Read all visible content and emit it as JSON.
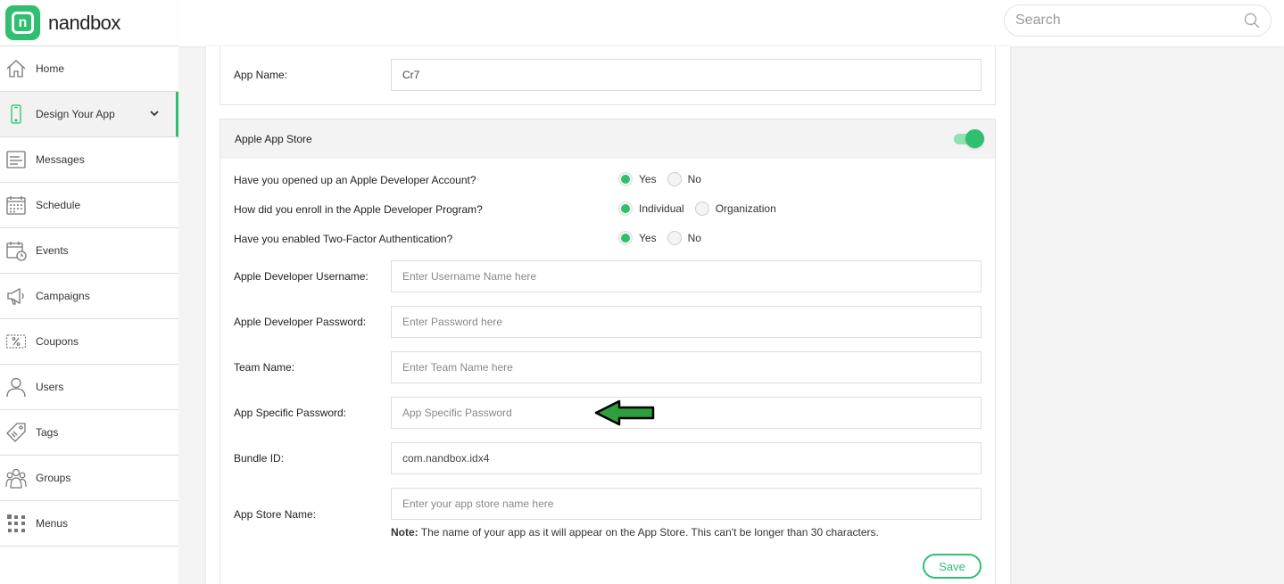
{
  "brand": {
    "name": "nandbox",
    "logo_letter": "n",
    "accent": "#2fbf71"
  },
  "search": {
    "placeholder": "Search"
  },
  "sidebar": {
    "items": [
      {
        "label": "Home",
        "icon": "home-icon"
      },
      {
        "label": "Design Your App",
        "icon": "phone-icon",
        "active": true
      },
      {
        "label": "Messages",
        "icon": "messages-icon"
      },
      {
        "label": "Schedule",
        "icon": "calendar-icon"
      },
      {
        "label": "Events",
        "icon": "events-icon"
      },
      {
        "label": "Campaigns",
        "icon": "megaphone-icon"
      },
      {
        "label": "Coupons",
        "icon": "coupon-icon"
      },
      {
        "label": "Users",
        "icon": "user-icon"
      },
      {
        "label": "Tags",
        "icon": "tag-icon"
      },
      {
        "label": "Groups",
        "icon": "groups-icon"
      },
      {
        "label": "Menus",
        "icon": "menus-icon"
      }
    ]
  },
  "form": {
    "app_name": {
      "label": "App Name:",
      "value": "Cr7"
    },
    "apple_store": {
      "title": "Apple App Store",
      "enabled": true,
      "questions": [
        {
          "label": "Have you opened up an Apple Developer Account?",
          "options": [
            "Yes",
            "No"
          ],
          "selected": "Yes"
        },
        {
          "label": "How did you enroll in the Apple Developer Program?",
          "options": [
            "Individual",
            "Organization"
          ],
          "selected": "Individual"
        },
        {
          "label": "Have you enabled Two-Factor Authentication?",
          "options": [
            "Yes",
            "No"
          ],
          "selected": "Yes"
        }
      ],
      "username": {
        "label": "Apple Developer Username:",
        "value": "",
        "placeholder": "Enter Username Name here"
      },
      "password": {
        "label": "Apple Developer Password:",
        "value": "",
        "placeholder": "Enter Password here"
      },
      "team_name": {
        "label": "Team Name:",
        "value": "",
        "placeholder": "Enter Team Name here"
      },
      "app_specific_password": {
        "label": "App Specific Password:",
        "value": "",
        "placeholder": "App Specific Password"
      },
      "bundle_id": {
        "label": "Bundle ID:",
        "value": "com.nandbox.idx4"
      },
      "app_store_name": {
        "label": "App Store Name:",
        "value": "",
        "placeholder": "Enter your app store name here"
      },
      "note_prefix": "Note:",
      "note_text": "The name of your app as it will appear on the App Store. This can't be longer than 30 characters.",
      "save_label": "Save"
    }
  }
}
